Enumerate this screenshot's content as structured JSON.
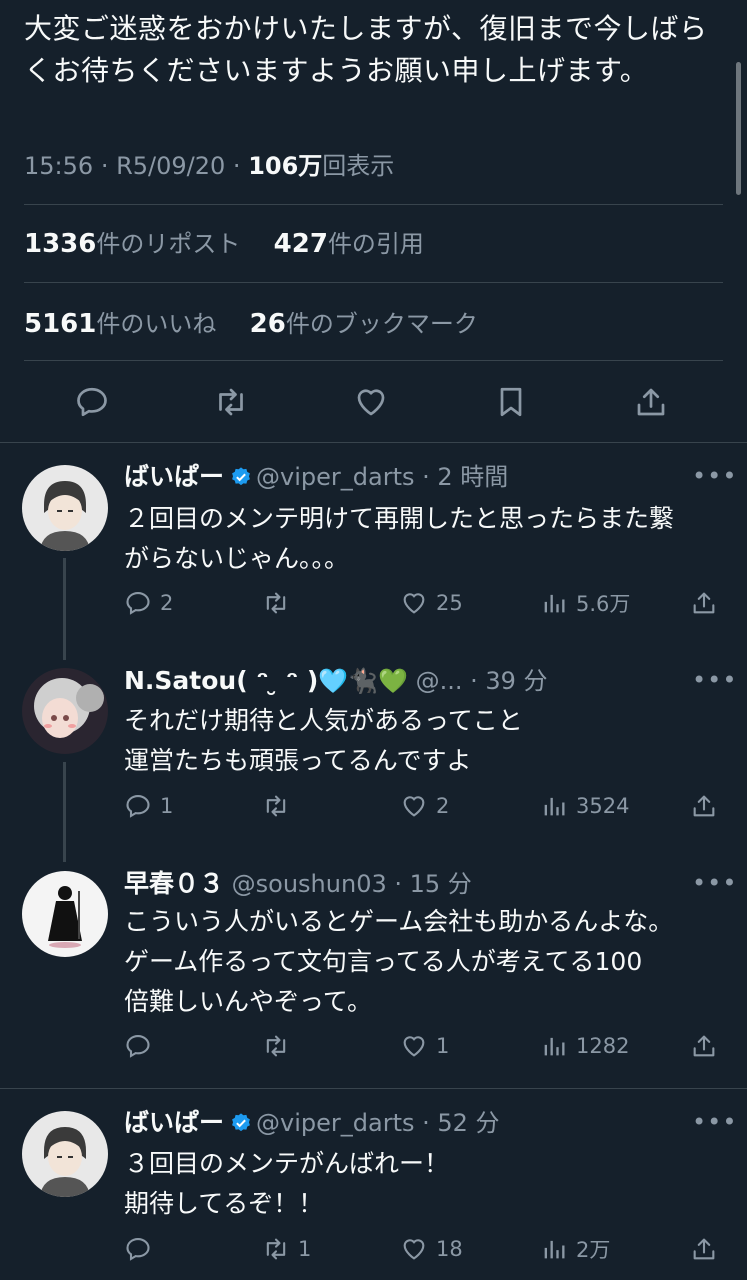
{
  "main_tweet": {
    "text": "大変ご迷惑をおかけいたしますが、復旧まで今しばらくお待ちくださいますようお願い申し上げます。",
    "time": "15:56",
    "date": "R5/09/20",
    "views_count": "106万",
    "views_label": "回表示",
    "reposts_count": "1336",
    "reposts_label": "件のリポスト",
    "quotes_count": "427",
    "quotes_label": "件の引用",
    "likes_count": "5161",
    "likes_label": "件のいいね",
    "bookmarks_count": "26",
    "bookmarks_label": "件のブックマーク"
  },
  "replies": [
    {
      "name": "ばいぱー",
      "handle": "@viper_darts",
      "time": "2 時間",
      "text_lines": [
        "２回目のメンテ明けて再開したと思ったらまた繋",
        "がらないじゃん。。。"
      ],
      "replies": "2",
      "reposts": "",
      "likes": "25",
      "views": "5.6万"
    },
    {
      "name": "N.Satou( ᵔ ̮ ᵔ )",
      "emoji": "🩵🐈‍⬛💚",
      "handle": "@...",
      "time": "39 分",
      "text_lines": [
        "それだけ期待と人気があるってこと",
        "運営たちも頑張ってるんですよ"
      ],
      "replies": "1",
      "reposts": "",
      "likes": "2",
      "views": "3524"
    },
    {
      "name": "早春０３",
      "handle": "@soushun03",
      "time": "15 分",
      "text_lines": [
        "こういう人がいるとゲーム会社も助かるんよな。",
        "ゲーム作るって文句言ってる人が考えてる100",
        "倍難しいんやぞって。"
      ],
      "replies": "",
      "reposts": "",
      "likes": "1",
      "views": "1282"
    },
    {
      "name": "ばいぱー",
      "handle": "@viper_darts",
      "time": "52 分",
      "text_lines": [
        "３回目のメンテがんばれー！",
        "期待してるぞ！！"
      ],
      "replies": "",
      "reposts": "1",
      "likes": "18",
      "views": "2万"
    }
  ],
  "colors": {
    "background": "#15202b",
    "text": "#e7e9ea",
    "muted": "#8b98a5",
    "divider": "#38444d",
    "verified": "#1d9bf0"
  }
}
